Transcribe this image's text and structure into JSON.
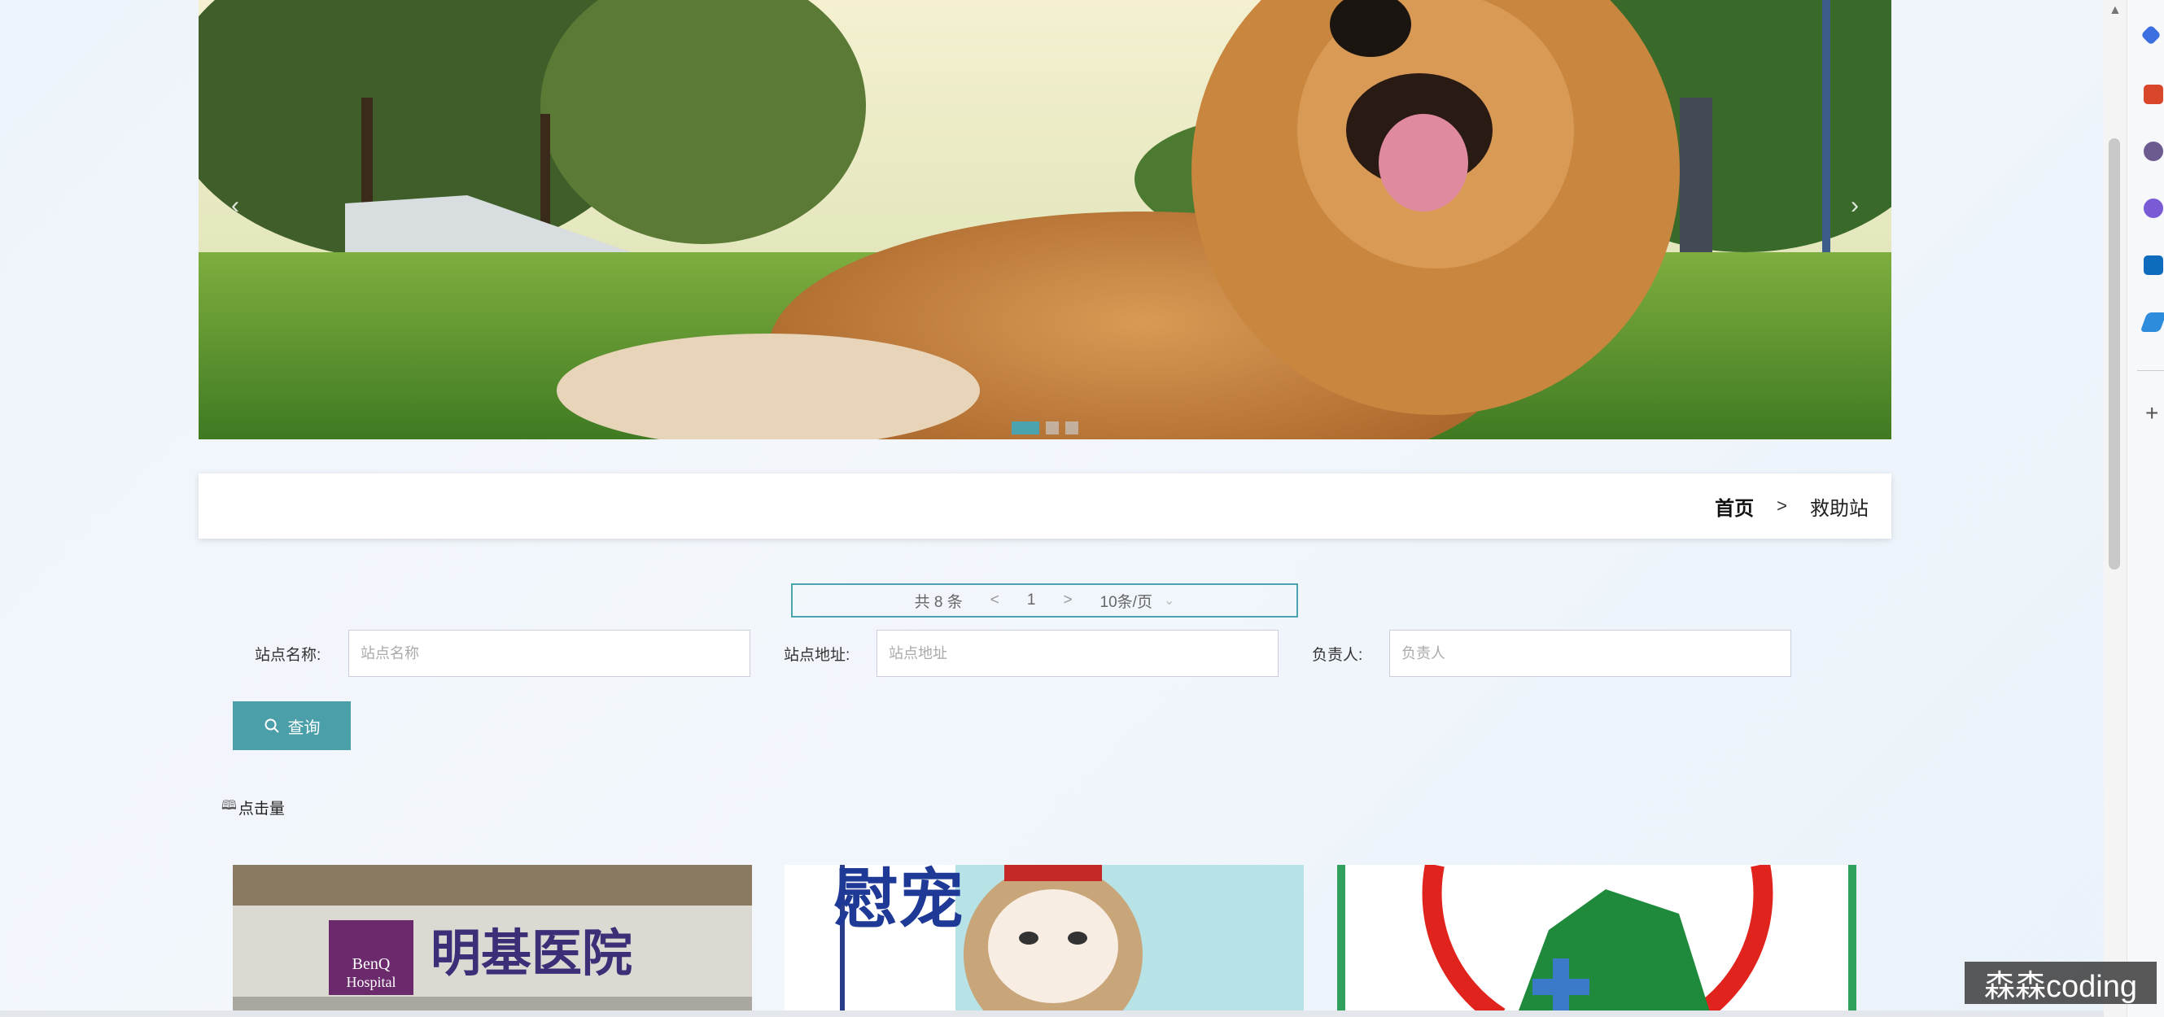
{
  "carousel": {
    "prev_arrow": "‹",
    "next_arrow": "›",
    "active_index": 1,
    "slide_count": 3
  },
  "breadcrumb": {
    "home": "首页",
    "separator": ">",
    "current": "救助站"
  },
  "pagination": {
    "total": "共 8 条",
    "prev": "<",
    "page": "1",
    "next": ">",
    "page_size": "10条/页"
  },
  "search": {
    "name_label": "站点名称:",
    "name_placeholder": "站点名称",
    "address_label": "站点地址:",
    "address_placeholder": "站点地址",
    "manager_label": "负责人:",
    "manager_placeholder": "负责人",
    "button_label": "查询"
  },
  "sort": {
    "label": "点击量"
  },
  "cards": [
    {
      "sign_text": "明基医院",
      "logo_line1": "BenQ",
      "logo_line2": "Hospital"
    },
    {
      "sign_text": "慰宠"
    },
    {
      "sign_text": ""
    }
  ],
  "watermark": "森森coding",
  "colors": {
    "accent": "#4a9fa8",
    "background": "#eef4fb"
  }
}
